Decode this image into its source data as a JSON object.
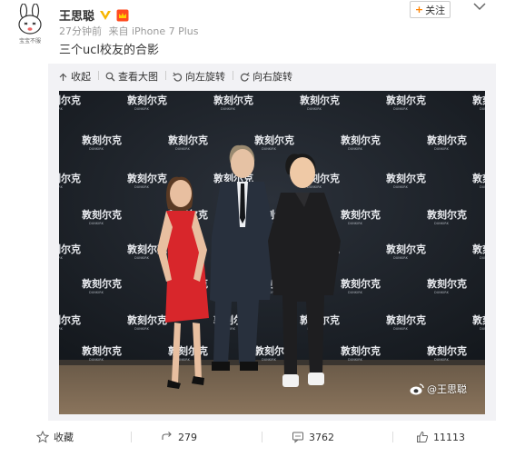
{
  "user": {
    "name": "王思聪",
    "avatar_caption": "宝宝不服"
  },
  "post": {
    "time": "27分钟前",
    "source": "来自 iPhone 7 Plus",
    "text": "三个ucl校友的合影"
  },
  "follow_label": "关注",
  "toolbar": {
    "collapse": "收起",
    "view_large": "查看大图",
    "rotate_left": "向左旋转",
    "rotate_right": "向右旋转"
  },
  "photo": {
    "backdrop_text": "敦刻尔克",
    "backdrop_subtext": "DUNKIRK",
    "watermark": "@王思聪"
  },
  "actions": {
    "collect": "收藏",
    "forward_count": "279",
    "comment_count": "3762",
    "like_count": "11113"
  },
  "colors": {
    "accent": "#ff8200",
    "media_bg": "#f2f2f5",
    "text_muted": "#999999",
    "backdrop": "#1b2026",
    "dress_red": "#d8262b"
  }
}
